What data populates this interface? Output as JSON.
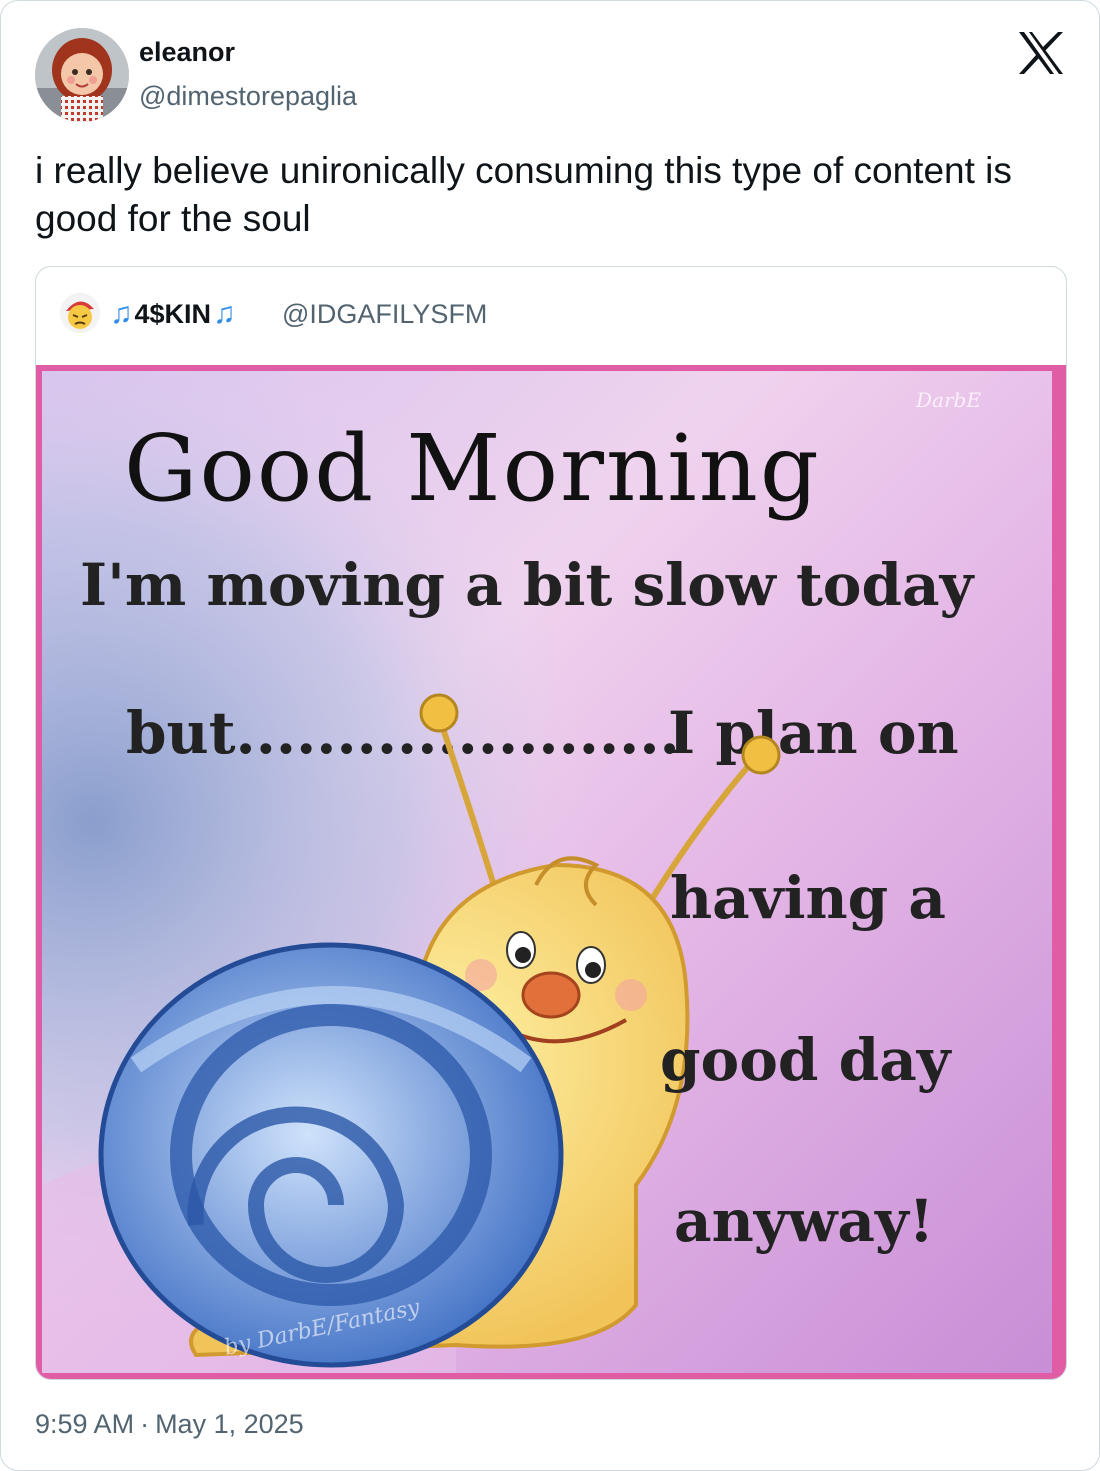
{
  "author": {
    "name": "eleanor",
    "handle": "@dimestorepaglia",
    "avatar_icon": "doll-avatar-icon"
  },
  "tweet": {
    "text": "i really believe unironically consuming this type of content is good for the soul"
  },
  "quoted": {
    "avatar_icon": "emoji-avatar-icon",
    "name": "4$KIN",
    "name_prefix_icon": "music-note-icon",
    "name_suffix_icon": "music-note-icon",
    "handle": "@IDGAFILYSFM",
    "image": {
      "title": "Good Morning",
      "line1": "I'm moving a bit slow today",
      "line2_left": "but......................",
      "line2_right": "I plan on",
      "line3": "having a",
      "line4": "good day",
      "line5": "anyway!",
      "watermark": "DarbE",
      "credit": "by DarbE/Fantasy",
      "border_color": "#e05ca5",
      "bg_colors": [
        "#c9b6e6",
        "#f2c9ea",
        "#9bb3d6"
      ]
    }
  },
  "timestamp": {
    "time": "9:59 AM",
    "separator": "·",
    "date": "May 1, 2025"
  },
  "x_logo_icon": "x-logo-icon"
}
